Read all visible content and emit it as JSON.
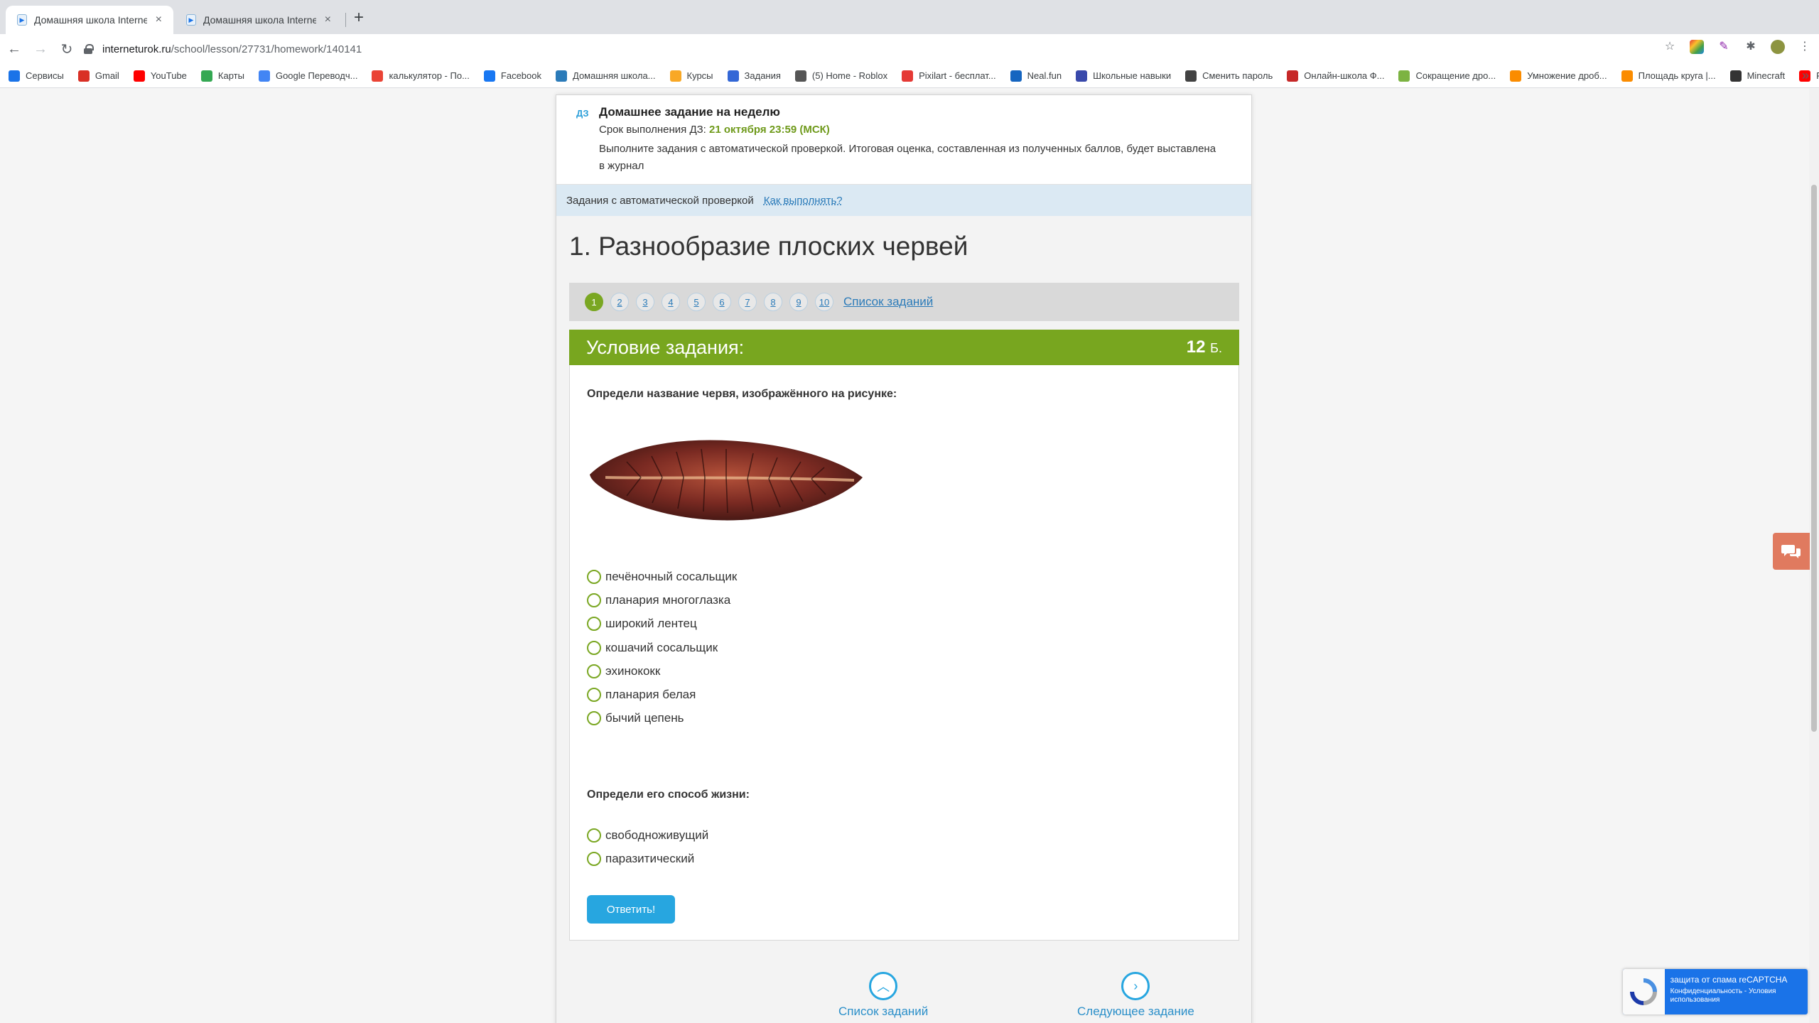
{
  "browser": {
    "tabs": [
      {
        "title": "Домашняя школа InternetUrok",
        "active": true
      },
      {
        "title": "Домашняя школа InternetUrok",
        "active": false
      }
    ],
    "url_host": "interneturok.ru",
    "url_path": "/school/lesson/27731/homework/140141",
    "bookmarks": [
      {
        "label": "Сервисы",
        "icon": "apps-grid-icon",
        "color": "#1a73e8"
      },
      {
        "label": "Gmail",
        "icon": "gmail-icon",
        "color": "#d93025"
      },
      {
        "label": "YouTube",
        "icon": "youtube-icon",
        "color": "#ff0000"
      },
      {
        "label": "Карты",
        "icon": "maps-pin-icon",
        "color": "#34a853"
      },
      {
        "label": "Google Переводч...",
        "icon": "translate-icon",
        "color": "#4285f4"
      },
      {
        "label": "калькулятор - По...",
        "icon": "google-g-icon",
        "color": "#ea4335"
      },
      {
        "label": "Facebook",
        "icon": "facebook-icon",
        "color": "#1877f2"
      },
      {
        "label": "Домашняя школа...",
        "icon": "interneturok-icon",
        "color": "#2b7bb9"
      },
      {
        "label": "Курсы",
        "icon": "courses-icon",
        "color": "#f9a825"
      },
      {
        "label": "Задания",
        "icon": "tasks-icon",
        "color": "#3367d6"
      },
      {
        "label": "(5) Home - Roblox",
        "icon": "roblox-icon",
        "color": "#555555"
      },
      {
        "label": "Pixilart - бесплат...",
        "icon": "pixilart-icon",
        "color": "#e53935"
      },
      {
        "label": "Neal.fun",
        "icon": "neal-icon",
        "color": "#1565c0"
      },
      {
        "label": "Школьные навыки",
        "icon": "skills-icon",
        "color": "#3949ab"
      },
      {
        "label": "Сменить пароль",
        "icon": "password-icon",
        "color": "#424242"
      },
      {
        "label": "Онлайн-школа Ф...",
        "icon": "school-icon",
        "color": "#c62828"
      },
      {
        "label": "Сокращение дро...",
        "icon": "fraction-icon",
        "color": "#7cb342"
      },
      {
        "label": "Умножение дроб...",
        "icon": "circle-orange-icon",
        "color": "#fb8c00"
      },
      {
        "label": "Площадь круга |...",
        "icon": "circle-orange-icon",
        "color": "#fb8c00"
      },
      {
        "label": "Minecraft",
        "icon": "minecraft-icon",
        "color": "#333333"
      },
      {
        "label": "Python",
        "icon": "youtube-icon",
        "color": "#ff0000"
      }
    ]
  },
  "homework": {
    "badge": "ДЗ",
    "title": "Домашнее задание на неделю",
    "deadline_label": "Срок выполнения ДЗ:",
    "deadline_value": "21 октября 23:59 (МСК)",
    "description": "Выполните задания с автоматической проверкой. Итоговая оценка, составленная из полученных баллов, будет выставлена в журнал"
  },
  "auto_bar": {
    "label": "Задания с автоматической проверкой",
    "howto": "Как выполнять?"
  },
  "lesson_title": "1. Разнообразие плоских червей",
  "pager": {
    "pages": [
      "1",
      "2",
      "3",
      "4",
      "5",
      "6",
      "7",
      "8",
      "9",
      "10"
    ],
    "active": "1",
    "list_link": "Список заданий"
  },
  "task": {
    "header": "Условие задания:",
    "points": "12",
    "points_unit": "Б.",
    "question1": "Определи название червя, изображённого на рисунке:",
    "options1": [
      "печёночный сосальщик",
      "планария многоглазка",
      "широкий лентец",
      "кошачий сосальщик",
      "эхинококк",
      "планария белая",
      "бычий цепень"
    ],
    "question2": "Определи его способ жизни:",
    "options2": [
      "свободноживущий",
      "паразитический"
    ],
    "answer_button": "Ответить!"
  },
  "bottom_nav": {
    "list": "Список заданий",
    "next": "Следующее задание"
  },
  "recaptcha": {
    "line1": "защита от спама reCAPTCHA",
    "line2": "Конфиденциальность - Условия использования"
  },
  "colors": {
    "accent_green": "#78a61f",
    "link_blue": "#2b7bb9",
    "button_blue": "#27a6e0"
  }
}
